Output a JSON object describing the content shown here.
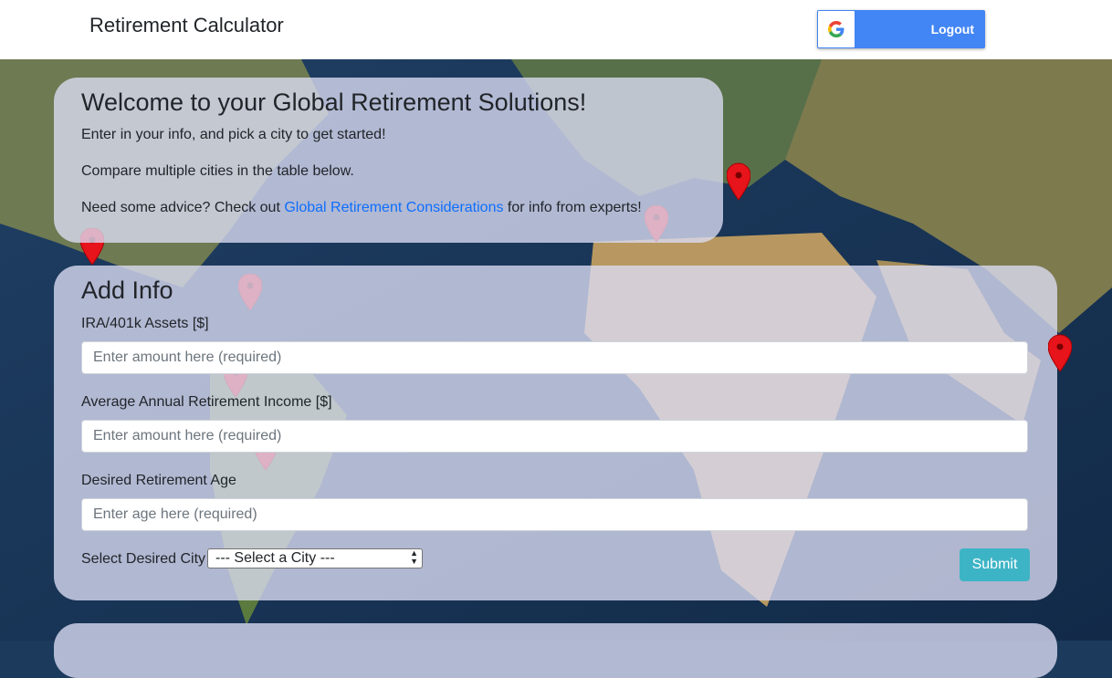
{
  "app": {
    "title": "Retirement Calculator"
  },
  "auth": {
    "button_label": "Logout",
    "icon": "google-icon"
  },
  "welcome": {
    "heading": "Welcome to your Global Retirement Solutions!",
    "line1": "Enter in your info, and pick a city to get started!",
    "line2": "Compare multiple cities in the table below.",
    "line3_prefix": "Need some advice? Check out ",
    "line3_link": "Global Retirement Considerations",
    "line3_suffix": " for info from experts!"
  },
  "form": {
    "heading": "Add Info",
    "assets_label": "IRA/401k Assets [$]",
    "assets_placeholder": "Enter amount here (required)",
    "income_label": "Average Annual Retirement Income [$]",
    "income_placeholder": "Enter amount here (required)",
    "age_label": "Desired Retirement Age",
    "age_placeholder": "Enter age here (required)",
    "city_label": "Select Desired City",
    "city_selected": "--- Select a City ---",
    "submit_label": "Submit"
  },
  "colors": {
    "link": "#0d6efd",
    "submit": "#3db4c6",
    "google_blue": "#4285f4",
    "pin_red": "#e8141b"
  }
}
